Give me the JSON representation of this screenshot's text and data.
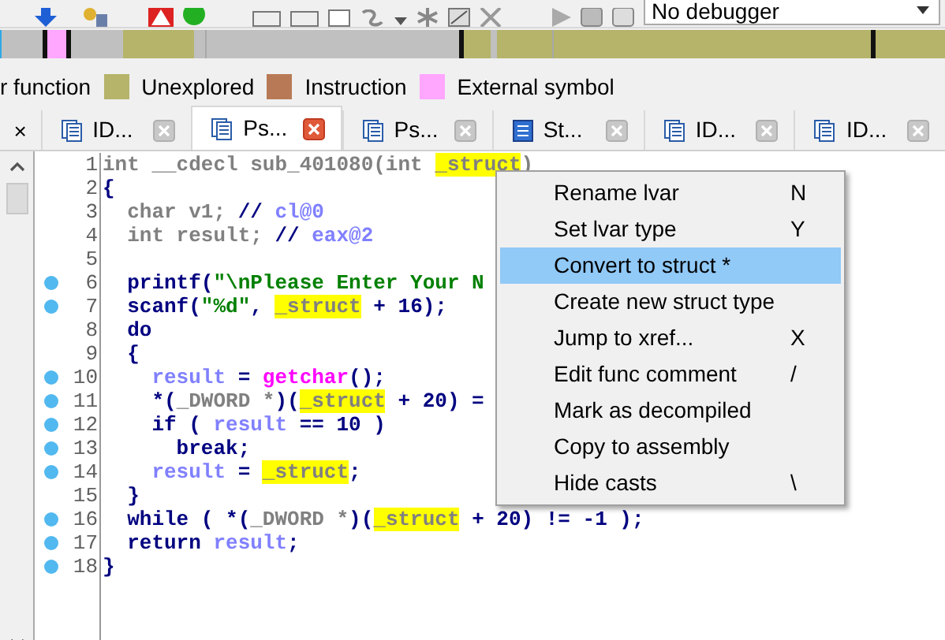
{
  "toolbar": {
    "debugger_select": "No debugger"
  },
  "legend": [
    {
      "label": "r function"
    },
    {
      "label": "Unexplored",
      "color": "#b5b46a"
    },
    {
      "label": "Instruction",
      "color": "#b87a56"
    },
    {
      "label": "External symbol",
      "color": "#ffa6ff"
    }
  ],
  "close_panel": "×",
  "tabs": [
    {
      "label": "ID...",
      "kind": "view",
      "selected": false
    },
    {
      "label": "Ps...",
      "kind": "view",
      "selected": true
    },
    {
      "label": "Ps...",
      "kind": "view",
      "selected": false
    },
    {
      "label": "St...",
      "kind": "structures",
      "selected": false
    },
    {
      "label": "ID...",
      "kind": "view",
      "selected": false
    },
    {
      "label": "ID...",
      "kind": "view",
      "selected": false
    }
  ],
  "code": [
    {
      "number": "1",
      "marked": false,
      "segments": [
        {
          "text": "int __cdecl sub_401080(int ",
          "kind": "decl"
        },
        {
          "text": "_struct",
          "kind": "highlight"
        },
        {
          "text": ")",
          "kind": "decl"
        }
      ]
    },
    {
      "number": "2",
      "marked": false,
      "segments": [
        {
          "text": "{",
          "kind": "plain"
        }
      ]
    },
    {
      "number": "3",
      "marked": false,
      "segments": [
        {
          "text": "  char v1; ",
          "kind": "decl"
        },
        {
          "text": "// ",
          "kind": "plain"
        },
        {
          "text": "cl@0",
          "kind": "var"
        }
      ]
    },
    {
      "number": "4",
      "marked": false,
      "segments": [
        {
          "text": "  int result; ",
          "kind": "decl"
        },
        {
          "text": "// ",
          "kind": "plain"
        },
        {
          "text": "eax@2",
          "kind": "var"
        }
      ]
    },
    {
      "number": "5",
      "marked": false
    },
    {
      "number": "6",
      "marked": true,
      "segments": [
        {
          "text": "  printf(",
          "kind": "plain"
        },
        {
          "text": "\"\\nPlease Enter Your N",
          "kind": "string"
        }
      ]
    },
    {
      "number": "7",
      "marked": true,
      "segments": [
        {
          "text": "  scanf(",
          "kind": "plain"
        },
        {
          "text": "\"%d\"",
          "kind": "string"
        },
        {
          "text": ", ",
          "kind": "plain"
        },
        {
          "text": "_struct",
          "kind": "highlight"
        },
        {
          "text": " + 16);",
          "kind": "plain"
        }
      ]
    },
    {
      "number": "8",
      "marked": false,
      "segments": [
        {
          "text": "  do",
          "kind": "plain"
        }
      ]
    },
    {
      "number": "9",
      "marked": false,
      "segments": [
        {
          "text": "  {",
          "kind": "plain"
        }
      ]
    },
    {
      "number": "10",
      "marked": true,
      "segments": [
        {
          "text": "    result",
          "kind": "var"
        },
        {
          "text": " = ",
          "kind": "plain"
        },
        {
          "text": "getchar",
          "kind": "func"
        },
        {
          "text": "();",
          "kind": "plain"
        }
      ]
    },
    {
      "number": "11",
      "marked": true,
      "segments": [
        {
          "text": "    *(",
          "kind": "plain"
        },
        {
          "text": "_DWORD *",
          "kind": "decl"
        },
        {
          "text": ")(",
          "kind": "plain"
        },
        {
          "text": "_struct",
          "kind": "highlight"
        },
        {
          "text": " + 20) =",
          "kind": "plain"
        }
      ]
    },
    {
      "number": "12",
      "marked": true,
      "segments": [
        {
          "text": "    if ( ",
          "kind": "plain"
        },
        {
          "text": "result",
          "kind": "var"
        },
        {
          "text": " == 10 )",
          "kind": "plain"
        }
      ]
    },
    {
      "number": "13",
      "marked": true,
      "segments": [
        {
          "text": "      break;",
          "kind": "plain"
        }
      ]
    },
    {
      "number": "14",
      "marked": true,
      "segments": [
        {
          "text": "    result",
          "kind": "var"
        },
        {
          "text": " = ",
          "kind": "plain"
        },
        {
          "text": "_struct",
          "kind": "highlight"
        },
        {
          "text": ";",
          "kind": "plain"
        }
      ]
    },
    {
      "number": "15",
      "marked": false,
      "segments": [
        {
          "text": "  }",
          "kind": "plain"
        }
      ]
    },
    {
      "number": "16",
      "marked": true,
      "segments": [
        {
          "text": "  while ( *(",
          "kind": "plain"
        },
        {
          "text": "_DWORD *",
          "kind": "decl"
        },
        {
          "text": ")(",
          "kind": "plain"
        },
        {
          "text": "_struct",
          "kind": "highlight"
        },
        {
          "text": " + 20) != -1 );",
          "kind": "plain"
        }
      ]
    },
    {
      "number": "17",
      "marked": true,
      "segments": [
        {
          "text": "  return ",
          "kind": "plain"
        },
        {
          "text": "result",
          "kind": "var"
        },
        {
          "text": ";",
          "kind": "plain"
        }
      ]
    },
    {
      "number": "18",
      "marked": true,
      "segments": [
        {
          "text": "}",
          "kind": "plain"
        }
      ]
    }
  ],
  "context_menu": [
    {
      "label": "Rename lvar",
      "shortcut": "N",
      "selected": false
    },
    {
      "label": "Set lvar type",
      "shortcut": "Y",
      "selected": false
    },
    {
      "label": "Convert to struct *",
      "selected": true
    },
    {
      "label": "Create new struct type",
      "selected": false
    },
    {
      "label": "Jump to xref...",
      "shortcut": "X",
      "selected": false
    },
    {
      "label": "Edit func comment",
      "shortcut": "/",
      "selected": false
    },
    {
      "label": "Mark as decompiled",
      "selected": false
    },
    {
      "label": "Copy to assembly",
      "selected": false
    },
    {
      "label": "Hide casts",
      "shortcut": "\\",
      "selected": false
    }
  ]
}
